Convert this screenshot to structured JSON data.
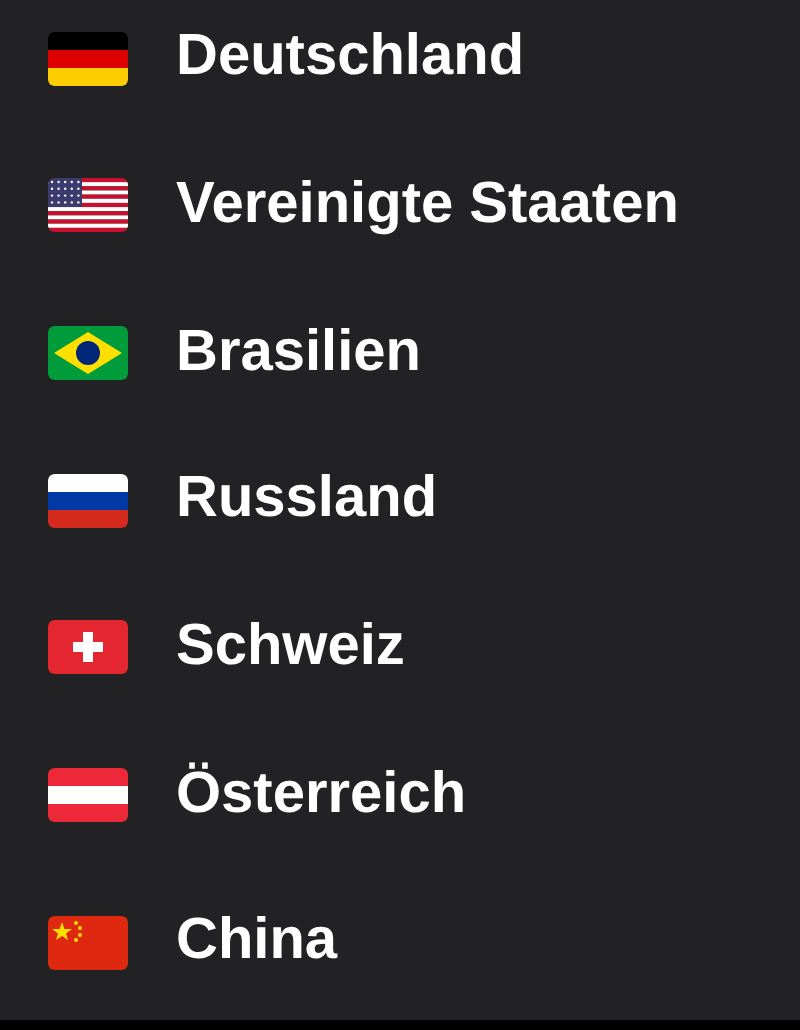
{
  "countries": [
    {
      "kind": "germany",
      "name": "Deutschland"
    },
    {
      "kind": "usa",
      "name": "Vereinigte Staaten"
    },
    {
      "kind": "brazil",
      "name": "Brasilien"
    },
    {
      "kind": "russia",
      "name": "Russland"
    },
    {
      "kind": "switzerland",
      "name": "Schweiz"
    },
    {
      "kind": "austria",
      "name": "Österreich"
    },
    {
      "kind": "china",
      "name": "China"
    }
  ]
}
